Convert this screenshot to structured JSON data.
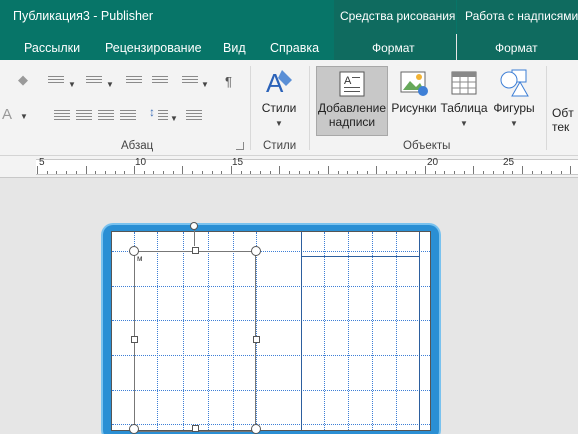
{
  "window": {
    "title": "Публикация3  -  Publisher"
  },
  "tabs": [
    "Рассылки",
    "Рецензирование",
    "Вид",
    "Справка"
  ],
  "contextual": [
    {
      "title": "Средства рисования",
      "tab": "Формат"
    },
    {
      "title": "Работа с надписями",
      "tab": "Формат"
    }
  ],
  "ribbon": {
    "paragraph_group": "Абзац",
    "styles_group": "Стили",
    "styles_button": "Стили",
    "objects_group": "Объекты",
    "add_textbox_line1": "Добавление",
    "add_textbox_line2": "надписи",
    "pictures": "Рисунки",
    "table": "Таблица",
    "shapes": "Фигуры",
    "cut_line1": "Обт",
    "cut_line2": "тек",
    "pilcrow": "¶",
    "a_letter": "A"
  },
  "ruler": {
    "numbers": [
      "5",
      "10",
      "15",
      "20",
      "25"
    ]
  },
  "canvas": {
    "margin_marker": "м"
  }
}
